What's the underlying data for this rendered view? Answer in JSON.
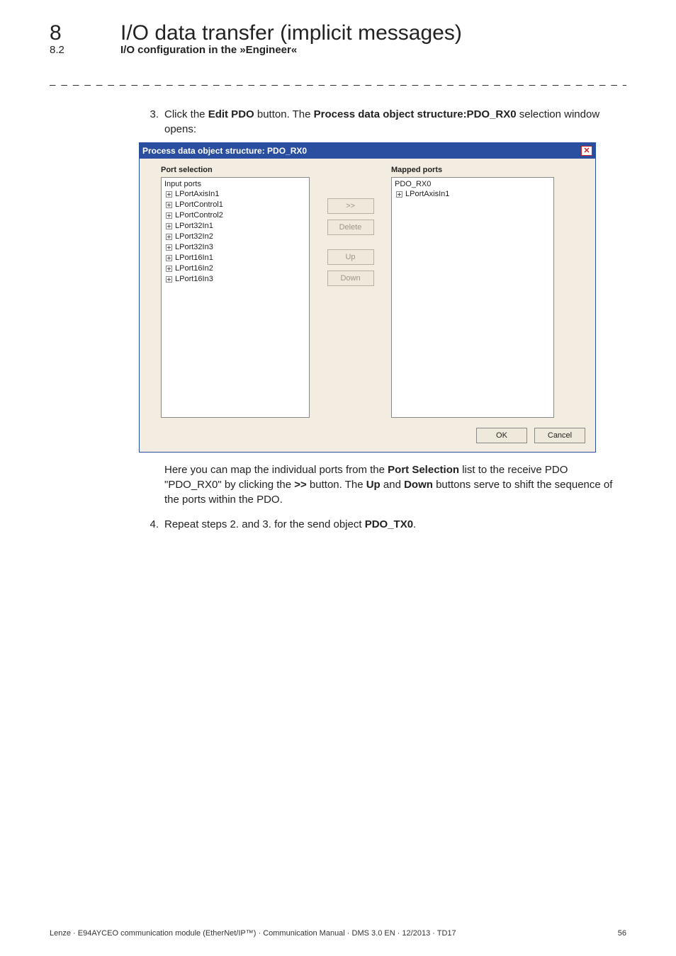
{
  "header": {
    "chapter_num": "8",
    "chapter_title": "I/O data transfer (implicit messages)",
    "section_num": "8.2",
    "section_title": "I/O configuration in the »Engineer«"
  },
  "separator": "_ _ _ _ _ _ _ _ _ _ _ _ _ _ _ _ _ _ _ _ _ _ _ _ _ _ _ _ _ _ _ _ _ _ _ _ _ _ _ _ _ _ _ _ _ _ _ _ _ _ _ _ _ _ _ _ _ _ _ _ _ _ _ _",
  "step3": {
    "num": "3.",
    "t1": "Click the ",
    "b1": "Edit PDO",
    "t2": " button. The ",
    "b2": "Process data object structure:PDO_RX0",
    "t3": " selection window opens:"
  },
  "dialog": {
    "title": "Process data object structure: PDO_RX0",
    "port_selection_label": "Port selection",
    "mapped_ports_label": "Mapped ports",
    "input_ports_label": "Input ports",
    "left_items": [
      "LPortAxisIn1",
      "LPortControl1",
      "LPortControl2",
      "LPort32In1",
      "LPort32In2",
      "LPort32In3",
      "LPort16In1",
      "LPort16In2",
      "LPort16In3"
    ],
    "right_root": "PDO_RX0",
    "right_items": [
      "LPortAxisIn1"
    ],
    "btn_move": ">>",
    "btn_delete": "Delete",
    "btn_up": "Up",
    "btn_down": "Down",
    "btn_ok": "OK",
    "btn_cancel": "Cancel"
  },
  "para1": {
    "t1": "Here you can map the individual ports from the ",
    "b1": "Port Selection",
    "t2": " list to the receive PDO \"PDO_RX0\" by clicking the ",
    "b2": ">>",
    "t3": " button. The ",
    "b3": "Up",
    "t4": " and ",
    "b4": "Down",
    "t5": " buttons serve to shift the sequence of the ports within the PDO."
  },
  "step4": {
    "num": "4.",
    "t1": "Repeat steps 2. and 3. for the send object ",
    "b1": "PDO_TX0",
    "t2": "."
  },
  "footer": {
    "left": "Lenze · E94AYCEO communication module (EtherNet/IP™) · Communication Manual · DMS 3.0 EN · 12/2013 · TD17",
    "right": "56"
  }
}
